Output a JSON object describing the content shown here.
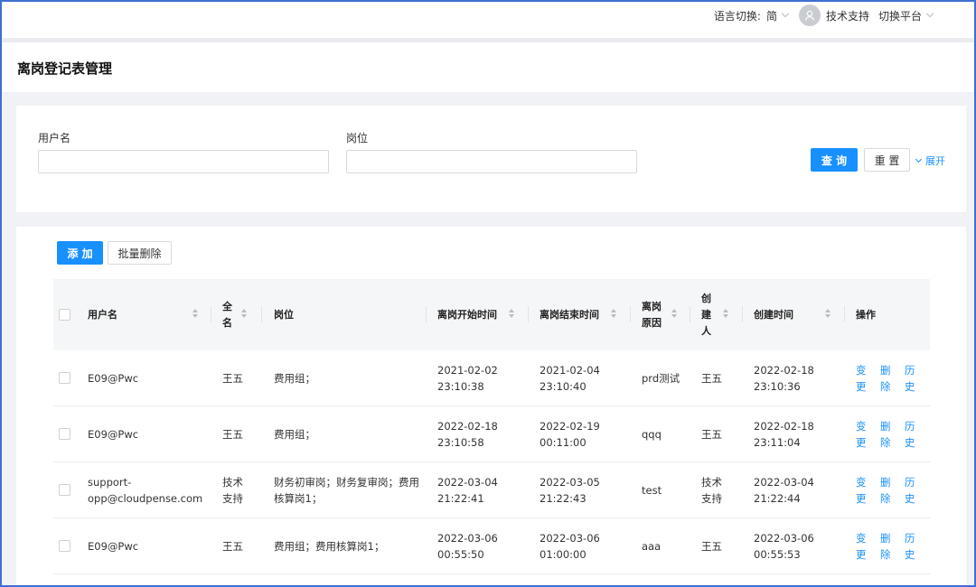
{
  "topbar": {
    "language_label": "语言切换:",
    "language_value": "简",
    "user_name": "技术支持",
    "switch_platform": "切换平台"
  },
  "page": {
    "title": "离岗登记表管理"
  },
  "search": {
    "username_label": "用户名",
    "username_value": "",
    "position_label": "岗位",
    "position_value": "",
    "query_button": "查 询",
    "reset_button": "重 置",
    "expand_link": "展开"
  },
  "toolbar": {
    "add_button": "添 加",
    "batch_delete_button": "批量删除"
  },
  "table": {
    "headers": {
      "username": "用户名",
      "fullname": "全\n名",
      "position": "岗位",
      "start_time": "离岗开始时间",
      "end_time": "离岗结束时间",
      "reason": "离岗\n原因",
      "creator": "创\n建\n人",
      "created_time": "创建时间",
      "actions": "操作"
    },
    "actions": {
      "change": "变\n更",
      "delete": "删\n除",
      "history": "历\n史"
    },
    "rows": [
      {
        "username": "E09@Pwc",
        "fullname": "王五",
        "position": "费用组；",
        "start": "2021-02-02\n23:10:38",
        "end": "2021-02-04\n23:10:40",
        "reason": "prd测试",
        "creator": "王五",
        "created": "2022-02-18\n23:10:36"
      },
      {
        "username": "E09@Pwc",
        "fullname": "王五",
        "position": "费用组；",
        "start": "2022-02-18\n23:10:58",
        "end": "2022-02-19\n00:11:00",
        "reason": "qqq",
        "creator": "王五",
        "created": "2022-02-18\n23:11:04"
      },
      {
        "username": "support-\nopp@cloudpense.com",
        "fullname": "技术\n支持",
        "position": "财务初审岗；财务复审岗；费用\n核算岗1；",
        "start": "2022-03-04\n21:22:41",
        "end": "2022-03-05\n21:22:43",
        "reason": "test",
        "creator": "技术\n支持",
        "created": "2022-03-04\n21:22:44"
      },
      {
        "username": "E09@Pwc",
        "fullname": "王五",
        "position": "费用组；费用核算岗1；",
        "start": "2022-03-06\n00:55:50",
        "end": "2022-03-06\n01:00:00",
        "reason": "aaa",
        "creator": "王五",
        "created": "2022-03-06\n00:55:53"
      }
    ]
  }
}
